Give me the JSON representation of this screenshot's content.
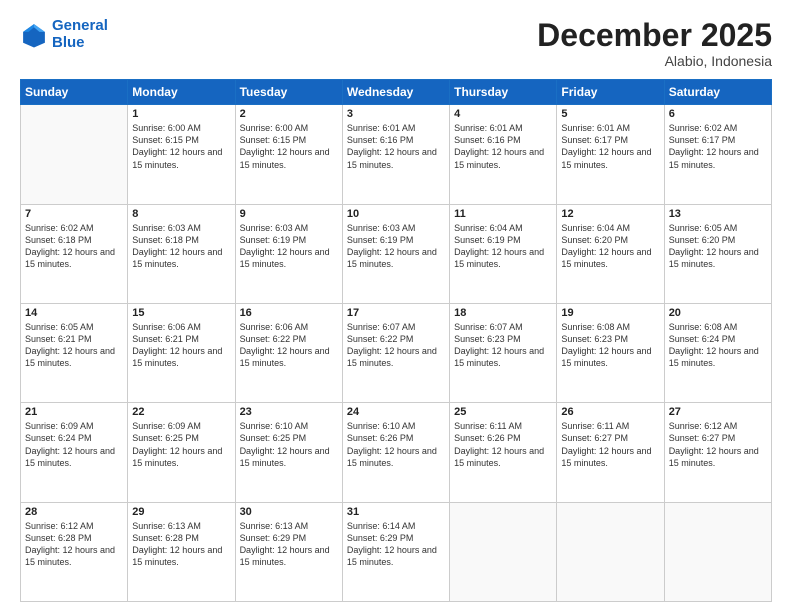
{
  "header": {
    "logo_line1": "General",
    "logo_line2": "Blue",
    "month_year": "December 2025",
    "location": "Alabio, Indonesia"
  },
  "weekdays": [
    "Sunday",
    "Monday",
    "Tuesday",
    "Wednesday",
    "Thursday",
    "Friday",
    "Saturday"
  ],
  "weeks": [
    [
      {
        "day": "",
        "sunrise": "",
        "sunset": "",
        "daylight": ""
      },
      {
        "day": "1",
        "sunrise": "Sunrise: 6:00 AM",
        "sunset": "Sunset: 6:15 PM",
        "daylight": "Daylight: 12 hours and 15 minutes."
      },
      {
        "day": "2",
        "sunrise": "Sunrise: 6:00 AM",
        "sunset": "Sunset: 6:15 PM",
        "daylight": "Daylight: 12 hours and 15 minutes."
      },
      {
        "day": "3",
        "sunrise": "Sunrise: 6:01 AM",
        "sunset": "Sunset: 6:16 PM",
        "daylight": "Daylight: 12 hours and 15 minutes."
      },
      {
        "day": "4",
        "sunrise": "Sunrise: 6:01 AM",
        "sunset": "Sunset: 6:16 PM",
        "daylight": "Daylight: 12 hours and 15 minutes."
      },
      {
        "day": "5",
        "sunrise": "Sunrise: 6:01 AM",
        "sunset": "Sunset: 6:17 PM",
        "daylight": "Daylight: 12 hours and 15 minutes."
      },
      {
        "day": "6",
        "sunrise": "Sunrise: 6:02 AM",
        "sunset": "Sunset: 6:17 PM",
        "daylight": "Daylight: 12 hours and 15 minutes."
      }
    ],
    [
      {
        "day": "7",
        "sunrise": "Sunrise: 6:02 AM",
        "sunset": "Sunset: 6:18 PM",
        "daylight": "Daylight: 12 hours and 15 minutes."
      },
      {
        "day": "8",
        "sunrise": "Sunrise: 6:03 AM",
        "sunset": "Sunset: 6:18 PM",
        "daylight": "Daylight: 12 hours and 15 minutes."
      },
      {
        "day": "9",
        "sunrise": "Sunrise: 6:03 AM",
        "sunset": "Sunset: 6:19 PM",
        "daylight": "Daylight: 12 hours and 15 minutes."
      },
      {
        "day": "10",
        "sunrise": "Sunrise: 6:03 AM",
        "sunset": "Sunset: 6:19 PM",
        "daylight": "Daylight: 12 hours and 15 minutes."
      },
      {
        "day": "11",
        "sunrise": "Sunrise: 6:04 AM",
        "sunset": "Sunset: 6:19 PM",
        "daylight": "Daylight: 12 hours and 15 minutes."
      },
      {
        "day": "12",
        "sunrise": "Sunrise: 6:04 AM",
        "sunset": "Sunset: 6:20 PM",
        "daylight": "Daylight: 12 hours and 15 minutes."
      },
      {
        "day": "13",
        "sunrise": "Sunrise: 6:05 AM",
        "sunset": "Sunset: 6:20 PM",
        "daylight": "Daylight: 12 hours and 15 minutes."
      }
    ],
    [
      {
        "day": "14",
        "sunrise": "Sunrise: 6:05 AM",
        "sunset": "Sunset: 6:21 PM",
        "daylight": "Daylight: 12 hours and 15 minutes."
      },
      {
        "day": "15",
        "sunrise": "Sunrise: 6:06 AM",
        "sunset": "Sunset: 6:21 PM",
        "daylight": "Daylight: 12 hours and 15 minutes."
      },
      {
        "day": "16",
        "sunrise": "Sunrise: 6:06 AM",
        "sunset": "Sunset: 6:22 PM",
        "daylight": "Daylight: 12 hours and 15 minutes."
      },
      {
        "day": "17",
        "sunrise": "Sunrise: 6:07 AM",
        "sunset": "Sunset: 6:22 PM",
        "daylight": "Daylight: 12 hours and 15 minutes."
      },
      {
        "day": "18",
        "sunrise": "Sunrise: 6:07 AM",
        "sunset": "Sunset: 6:23 PM",
        "daylight": "Daylight: 12 hours and 15 minutes."
      },
      {
        "day": "19",
        "sunrise": "Sunrise: 6:08 AM",
        "sunset": "Sunset: 6:23 PM",
        "daylight": "Daylight: 12 hours and 15 minutes."
      },
      {
        "day": "20",
        "sunrise": "Sunrise: 6:08 AM",
        "sunset": "Sunset: 6:24 PM",
        "daylight": "Daylight: 12 hours and 15 minutes."
      }
    ],
    [
      {
        "day": "21",
        "sunrise": "Sunrise: 6:09 AM",
        "sunset": "Sunset: 6:24 PM",
        "daylight": "Daylight: 12 hours and 15 minutes."
      },
      {
        "day": "22",
        "sunrise": "Sunrise: 6:09 AM",
        "sunset": "Sunset: 6:25 PM",
        "daylight": "Daylight: 12 hours and 15 minutes."
      },
      {
        "day": "23",
        "sunrise": "Sunrise: 6:10 AM",
        "sunset": "Sunset: 6:25 PM",
        "daylight": "Daylight: 12 hours and 15 minutes."
      },
      {
        "day": "24",
        "sunrise": "Sunrise: 6:10 AM",
        "sunset": "Sunset: 6:26 PM",
        "daylight": "Daylight: 12 hours and 15 minutes."
      },
      {
        "day": "25",
        "sunrise": "Sunrise: 6:11 AM",
        "sunset": "Sunset: 6:26 PM",
        "daylight": "Daylight: 12 hours and 15 minutes."
      },
      {
        "day": "26",
        "sunrise": "Sunrise: 6:11 AM",
        "sunset": "Sunset: 6:27 PM",
        "daylight": "Daylight: 12 hours and 15 minutes."
      },
      {
        "day": "27",
        "sunrise": "Sunrise: 6:12 AM",
        "sunset": "Sunset: 6:27 PM",
        "daylight": "Daylight: 12 hours and 15 minutes."
      }
    ],
    [
      {
        "day": "28",
        "sunrise": "Sunrise: 6:12 AM",
        "sunset": "Sunset: 6:28 PM",
        "daylight": "Daylight: 12 hours and 15 minutes."
      },
      {
        "day": "29",
        "sunrise": "Sunrise: 6:13 AM",
        "sunset": "Sunset: 6:28 PM",
        "daylight": "Daylight: 12 hours and 15 minutes."
      },
      {
        "day": "30",
        "sunrise": "Sunrise: 6:13 AM",
        "sunset": "Sunset: 6:29 PM",
        "daylight": "Daylight: 12 hours and 15 minutes."
      },
      {
        "day": "31",
        "sunrise": "Sunrise: 6:14 AM",
        "sunset": "Sunset: 6:29 PM",
        "daylight": "Daylight: 12 hours and 15 minutes."
      },
      {
        "day": "",
        "sunrise": "",
        "sunset": "",
        "daylight": ""
      },
      {
        "day": "",
        "sunrise": "",
        "sunset": "",
        "daylight": ""
      },
      {
        "day": "",
        "sunrise": "",
        "sunset": "",
        "daylight": ""
      }
    ]
  ]
}
